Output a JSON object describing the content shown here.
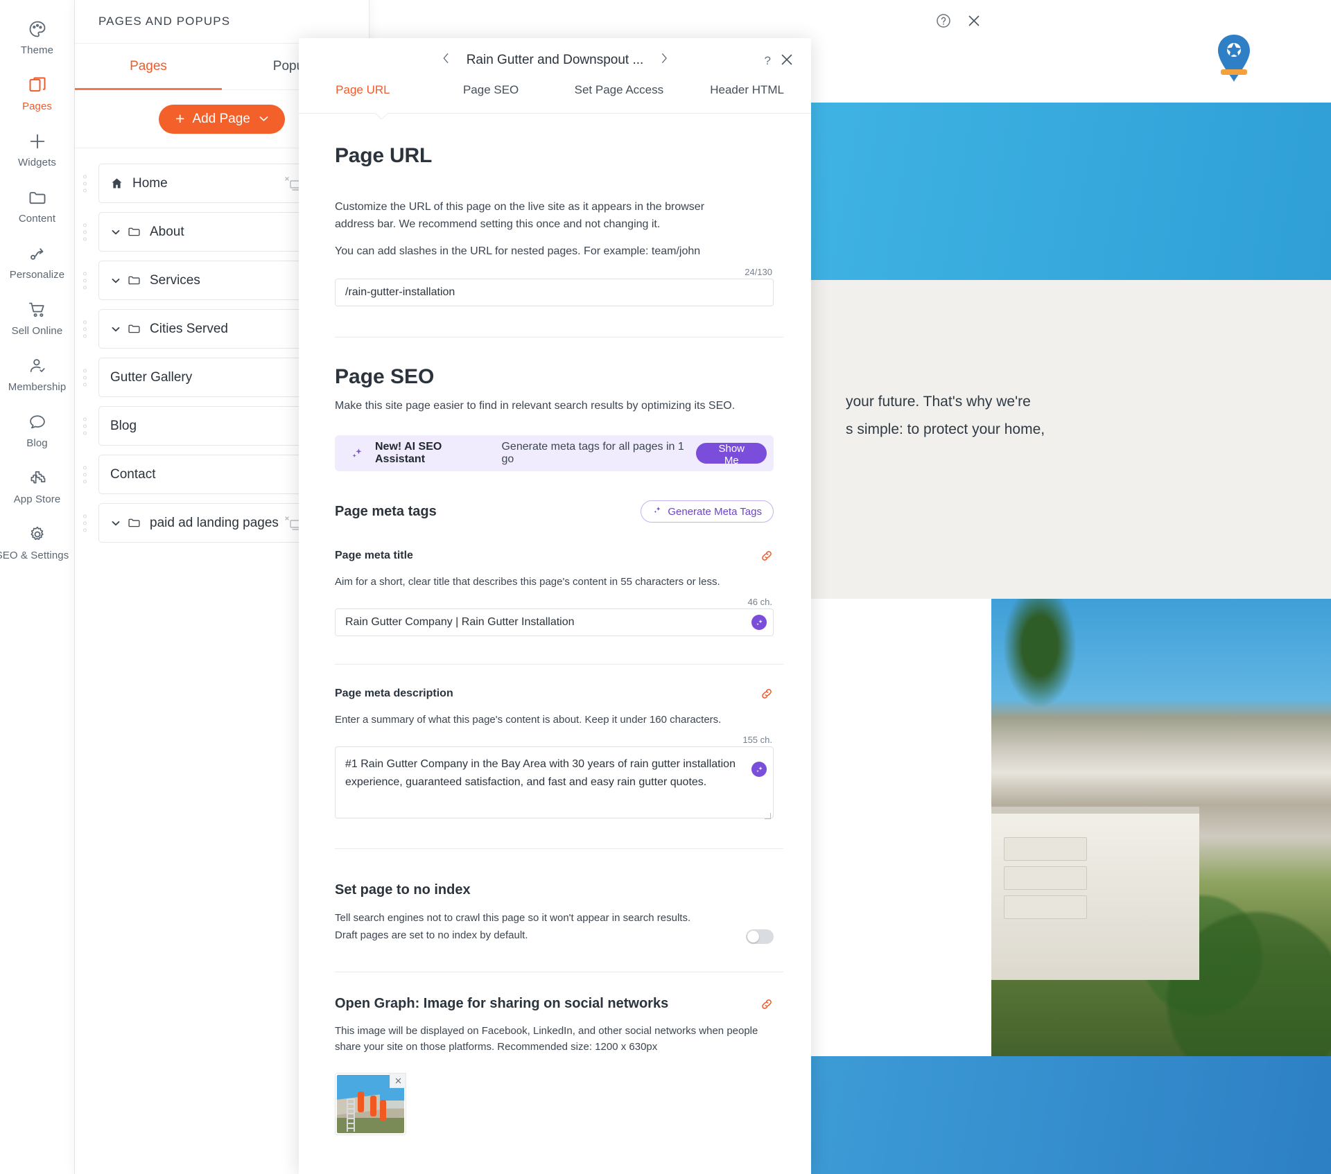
{
  "rail": {
    "items": [
      {
        "label": "Theme",
        "icon": "palette-icon",
        "active": false
      },
      {
        "label": "Pages",
        "icon": "pages-icon",
        "active": true
      },
      {
        "label": "Widgets",
        "icon": "plus-icon",
        "active": false
      },
      {
        "label": "Content",
        "icon": "folder-icon",
        "active": false
      },
      {
        "label": "Personalize",
        "icon": "path-arrow-icon",
        "active": false
      },
      {
        "label": "Sell Online",
        "icon": "cart-icon",
        "active": false
      },
      {
        "label": "Membership",
        "icon": "user-check-icon",
        "active": false
      },
      {
        "label": "Blog",
        "icon": "chat-bubble-icon",
        "active": false
      },
      {
        "label": "App Store",
        "icon": "puzzle-icon",
        "active": false
      },
      {
        "label": "SEO & Settings",
        "icon": "gear-icon",
        "active": false
      }
    ]
  },
  "pages_panel": {
    "header_title": "PAGES AND POPUPS",
    "help_icon": "help-icon",
    "close_icon": "close-icon",
    "tabs": [
      {
        "label": "Pages",
        "active": true
      },
      {
        "label": "Popups",
        "active": false
      }
    ],
    "add_page_label": "Add Page",
    "add_page_plus": "+",
    "add_page_caret": "⌄",
    "items": [
      {
        "label": "Home",
        "icon": "home-icon",
        "folder": false,
        "expandable": false,
        "has_hidden_icon": true,
        "menu": "•••"
      },
      {
        "label": "About",
        "icon": "folder-icon",
        "folder": true,
        "expandable": true,
        "has_hidden_icon": false,
        "menu": "•••"
      },
      {
        "label": "Services",
        "icon": "folder-icon",
        "folder": true,
        "expandable": true,
        "has_hidden_icon": false,
        "menu": "•••"
      },
      {
        "label": "Cities Served",
        "icon": "folder-icon",
        "folder": true,
        "expandable": true,
        "has_hidden_icon": false,
        "menu": "•••"
      },
      {
        "label": "Gutter Gallery",
        "icon": "none",
        "folder": false,
        "expandable": false,
        "has_hidden_icon": false,
        "menu": "•••"
      },
      {
        "label": "Blog",
        "icon": "none",
        "folder": false,
        "expandable": false,
        "has_hidden_icon": false,
        "menu": "•••"
      },
      {
        "label": "Contact",
        "icon": "none",
        "folder": false,
        "expandable": false,
        "has_hidden_icon": false,
        "menu": "•••"
      },
      {
        "label": "paid ad landing pages",
        "icon": "folder-icon",
        "folder": true,
        "expandable": true,
        "has_hidden_icon": true,
        "menu": "•••"
      }
    ]
  },
  "settings_modal": {
    "nav": {
      "prev_icon": "chevron-left-icon",
      "next_icon": "chevron-right-icon",
      "title": "Rain Gutter and Downspout ..."
    },
    "help_label": "?",
    "close_icon": "close-icon",
    "tabs": [
      {
        "label": "Page URL",
        "active": true
      },
      {
        "label": "Page SEO",
        "active": false
      },
      {
        "label": "Set Page Access",
        "active": false
      },
      {
        "label": "Header HTML",
        "active": false
      }
    ],
    "page_url": {
      "heading": "Page URL",
      "desc1": "Customize the URL of this page on the live site as it appears in the browser address bar. We recommend setting this once and not changing it.",
      "desc2": "You can add slashes in the URL for nested pages. For example: team/john",
      "char_count": "24/130",
      "value": "/rain-gutter-installation"
    },
    "page_seo": {
      "heading": "Page SEO",
      "subtitle": "Make this site page easier to find in relevant search results by optimizing its SEO.",
      "ai_banner": {
        "badge_icon": "sparkle-icon",
        "strong": "New! AI SEO Assistant",
        "text": "Generate meta tags for all pages in 1 go",
        "button": "Show Me",
        "accent": "#7b4ddb",
        "background": "#f1ecfd"
      },
      "meta_tags_heading": "Page meta tags",
      "generate_button": "Generate Meta Tags",
      "generate_icon": "sparkle-icon",
      "meta_title": {
        "label": "Page meta title",
        "link_icon": "link-icon",
        "help": "Aim for a short, clear title that describes this page's content in 55 characters or less.",
        "char_count": "46 ch.",
        "value": "Rain Gutter Company | Rain Gutter Installation",
        "ai_icon": "sparkle-icon"
      },
      "meta_description": {
        "label": "Page meta description",
        "link_icon": "link-icon",
        "help": "Enter a summary of what this page's content is about. Keep it under 160 characters.",
        "char_count": "155 ch.",
        "value": "#1 Rain Gutter Company in the Bay Area with 30 years of rain gutter installation experience, guaranteed satisfaction, and fast and easy rain gutter quotes.",
        "ai_icon": "sparkle-icon"
      },
      "no_index": {
        "heading": "Set page to no index",
        "desc": "Tell search engines not to crawl this page so it won't appear in search results. Draft pages are set to no index by default.",
        "toggle_on": false
      },
      "open_graph": {
        "heading": "Open Graph: Image for sharing on social networks",
        "desc": "This image will be displayed on Facebook, LinkedIn, and other social networks when people share your site on those platforms. Recommended size: 1200 x 630px",
        "link_icon": "link-icon",
        "thumb_remove_icon": "close-icon"
      }
    }
  },
  "site_preview": {
    "copy_line1": "your future. That's why we're",
    "copy_line2": "s simple: to protect your home,",
    "logo_icon": "map-pin-logo-icon",
    "hero_color": "#34abdf",
    "footer_color": "#3190d1"
  },
  "colors": {
    "accent_orange": "#f15a29",
    "purple": "#7b4ddb",
    "text_dark": "#2b333c",
    "text_muted": "#5a6672",
    "border": "#e4e6e8"
  }
}
